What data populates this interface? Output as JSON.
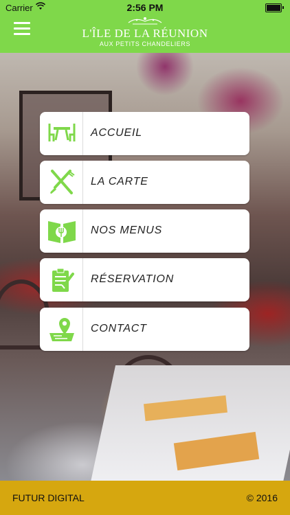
{
  "status_bar": {
    "carrier": "Carrier",
    "time": "2:56 PM"
  },
  "header": {
    "brand_name": "L'ÎLE DE LA RÉUNION",
    "brand_subtitle": "AUX PETITS CHANDELIERS"
  },
  "menu": {
    "items": [
      {
        "label": "ACCUEIL",
        "icon": "table-chairs-icon"
      },
      {
        "label": "LA CARTE",
        "icon": "fork-knife-icon"
      },
      {
        "label": "NOS MENUS",
        "icon": "menu-book-icon"
      },
      {
        "label": "RÉSERVATION",
        "icon": "clipboard-check-icon"
      },
      {
        "label": "CONTACT",
        "icon": "map-pin-icon"
      }
    ]
  },
  "footer": {
    "left": "FUTUR DIGITAL",
    "right": "© 2016"
  },
  "colors": {
    "header_bg": "#7fd84a",
    "icon_green": "#7fd84a",
    "footer_bg": "#d6a70f"
  }
}
